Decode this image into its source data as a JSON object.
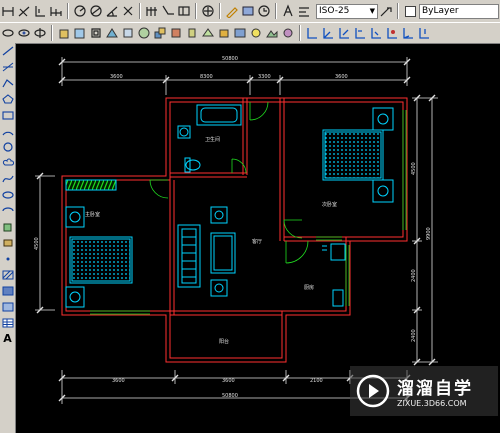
{
  "toolbar": {
    "dimstyle_value": "ISO-25",
    "layer_value": "ByLayer",
    "top_icons": [
      "linear-dim-icon",
      "aligned-dim-icon",
      "ordinate-dim-icon",
      "baseline-dim-icon",
      "radius-dim-icon",
      "diameter-dim-icon",
      "angular-dim-icon",
      "quick-dim-icon",
      "continue-dim-icon",
      "leader-icon",
      "tolerance-icon",
      "center-mark-icon",
      "dimedit-icon",
      "dimtedit-icon",
      "update-dim-icon",
      "text-style-icon",
      "dimstyle-icon"
    ],
    "second_icons": [
      "view-icon",
      "viewport-icon",
      "3dorbit-icon",
      "box-icon",
      "sphere-icon",
      "cylinder-icon",
      "cone-icon",
      "wedge-icon",
      "torus-icon",
      "union-icon",
      "subtract-icon",
      "intersect-icon",
      "slice-icon",
      "section-icon",
      "render-icon",
      "light-icon",
      "scene-icon",
      "material-icon",
      "ucs-icon",
      "ucs-world-icon",
      "ucs-prev-icon",
      "ucs-face-icon",
      "ucs-object-icon",
      "ucs-view-icon",
      "ucs-origin-icon",
      "ucs-zaxis-icon"
    ]
  },
  "draw_toolbar": {
    "tools": [
      "line-tool",
      "construction-line-tool",
      "polyline-tool",
      "polygon-tool",
      "rectangle-tool",
      "arc-tool",
      "circle-tool",
      "revision-cloud-tool",
      "spline-tool",
      "ellipse-tool",
      "ellipse-arc-tool",
      "insert-block-tool",
      "make-block-tool",
      "point-tool",
      "hatch-tool",
      "gradient-tool",
      "region-tool",
      "table-tool",
      "multiline-text-tool"
    ],
    "text_tool_label": "A"
  },
  "drawing": {
    "dims_top_total": "50800",
    "dims_top": [
      "3600",
      "8300",
      "3300",
      "3600"
    ],
    "dims_bottom": [
      "3600",
      "3600",
      "2100"
    ],
    "dims_bottom_total": "50800",
    "dims_right": [
      "4500",
      "2400",
      "2400"
    ],
    "dims_right_total": "9900",
    "dim_left": "4500",
    "rooms": {
      "bathroom": "卫生间",
      "bedroom_left": "主卧室",
      "bedroom_right": "次卧室",
      "living": "客厅",
      "kitchen": "厨房",
      "balcony": "阳台"
    }
  },
  "watermark": {
    "brand": "溜溜自学",
    "url": "ZIXUE.3D66.COM"
  },
  "colors": {
    "wall": "#ff3030",
    "dim": "#e0e0e0",
    "furniture": "#00d4ff",
    "window": "#20dd20"
  }
}
